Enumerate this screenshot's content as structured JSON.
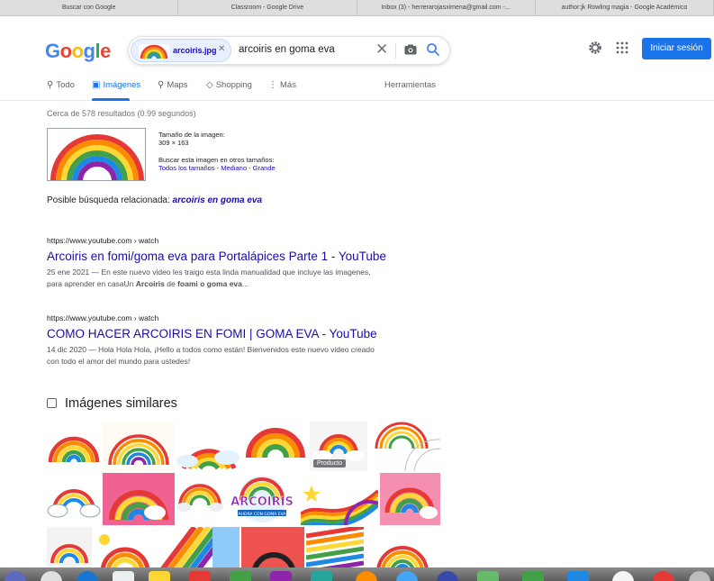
{
  "browser": {
    "tabs": [
      "Buscar con Google",
      "Classroom - Google Drive",
      "Inbox (3) - herrerarojasximena@gmail.com -...",
      "author:jk Rowling magia - Google Académico"
    ]
  },
  "header": {
    "logo_letters": [
      "G",
      "o",
      "o",
      "g",
      "l",
      "e"
    ],
    "logo_colors": [
      "#4285f4",
      "#ea4335",
      "#fbbc05",
      "#4285f4",
      "#34a853",
      "#ea4335"
    ],
    "chip_label": "arcoiris.jpg",
    "query": "arcoiris en goma eva",
    "signin_label": "Iniciar sesión"
  },
  "nav": {
    "items": [
      {
        "icon": "search-icon",
        "glyph": "⚲",
        "label": "Todo"
      },
      {
        "icon": "image-icon",
        "glyph": "▣",
        "label": "Imágenes",
        "active": true
      },
      {
        "icon": "map-pin-icon",
        "glyph": "⚲",
        "label": "Maps"
      },
      {
        "icon": "tag-icon",
        "glyph": "◇",
        "label": "Shopping"
      },
      {
        "icon": "more-icon",
        "glyph": "⋮",
        "label": "Más"
      }
    ],
    "tools": "Herramientas"
  },
  "stats": "Cerca de 578 resultados (0.99 segundos)",
  "image_info": {
    "size_label": "Tamaño de la imagen:",
    "size_value": "309 × 163",
    "other_sizes_label": "Buscar esta imagen en otros tamaños:",
    "sizes": [
      "Todos los tamaños",
      "Mediano",
      "Grande"
    ],
    "sep": " - "
  },
  "related": {
    "label": "Posible búsqueda relacionada: ",
    "query": "arcoiris en goma eva"
  },
  "results": [
    {
      "url": "https://www.youtube.com › watch",
      "title": "Arcoiris en fomi/goma eva para Portalápices Parte 1 - YouTube",
      "snippet_1": "25 ene 2021 — En este nuevo video les traigo esta linda manualidad que incluye las imagenes,",
      "snippet_2a": "para aprender en casaUn ",
      "snippet_2b": "Arcoiris",
      "snippet_2c": " de ",
      "snippet_2d": "foami o goma eva",
      "snippet_2e": "..."
    },
    {
      "url": "https://www.youtube.com › watch",
      "title": "COMO HACER ARCOIRIS EN FOMI | GOMA EVA - YouTube",
      "snippet_1": "14 dic 2020 — Hola Hola Hola, ¡Hello a todos como están! Bienvenidos este nuevo video creado",
      "snippet_2a": "con todo el amor del mundo para ustedes!"
    }
  ],
  "similar": {
    "heading": "Imágenes similares",
    "product_badge": "Producto",
    "arcoiris_text": "ARCOIRIS",
    "arcoiris_sub": "AHORA CON GOMA EVA"
  }
}
